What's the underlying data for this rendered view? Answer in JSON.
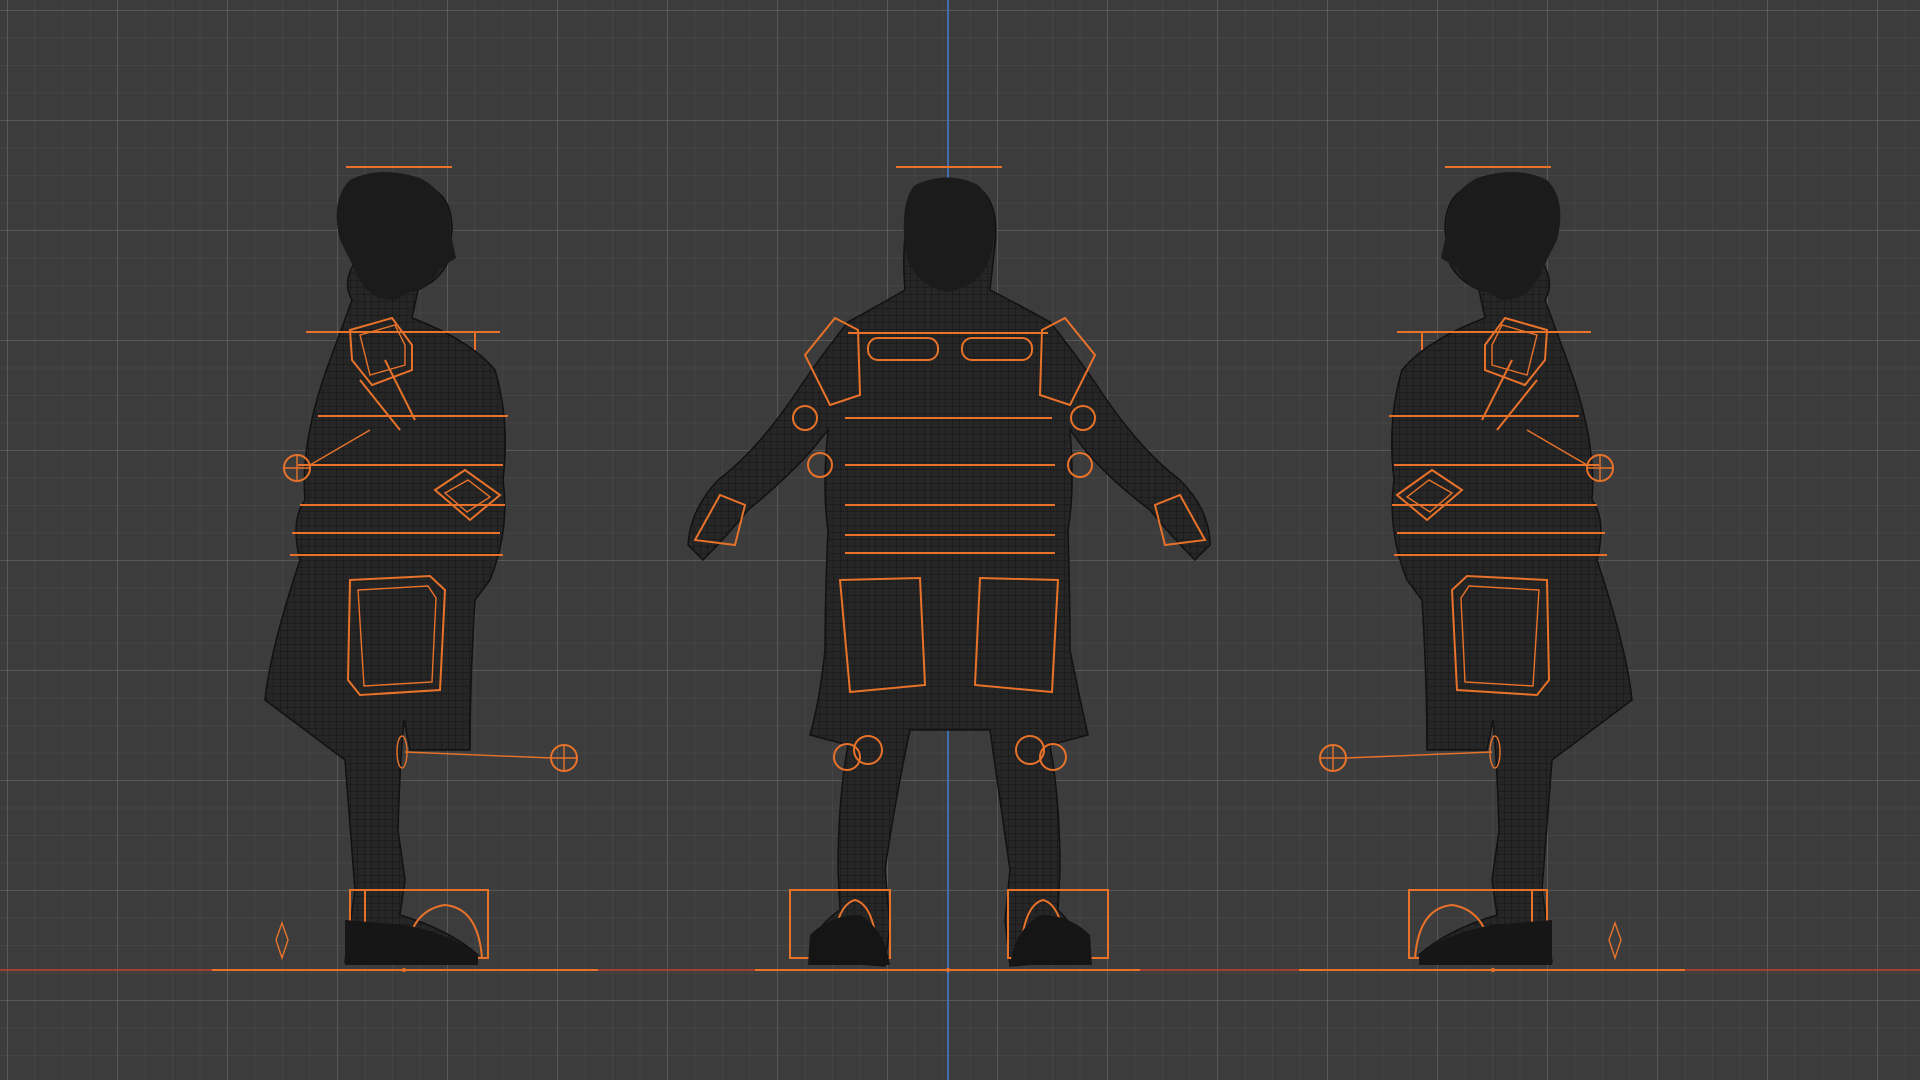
{
  "viewport": {
    "background": "#3c3c3c",
    "grid_major": "#4e4e4e",
    "axis_vertical_color": "#3f7fd6",
    "axis_horizontal_color": "#c0412f",
    "rig_color": "#e8722a",
    "mesh_color": "#111111"
  },
  "views": [
    {
      "name": "side-left",
      "facing": "right"
    },
    {
      "name": "front",
      "facing": "front"
    },
    {
      "name": "side-right",
      "facing": "left"
    }
  ]
}
